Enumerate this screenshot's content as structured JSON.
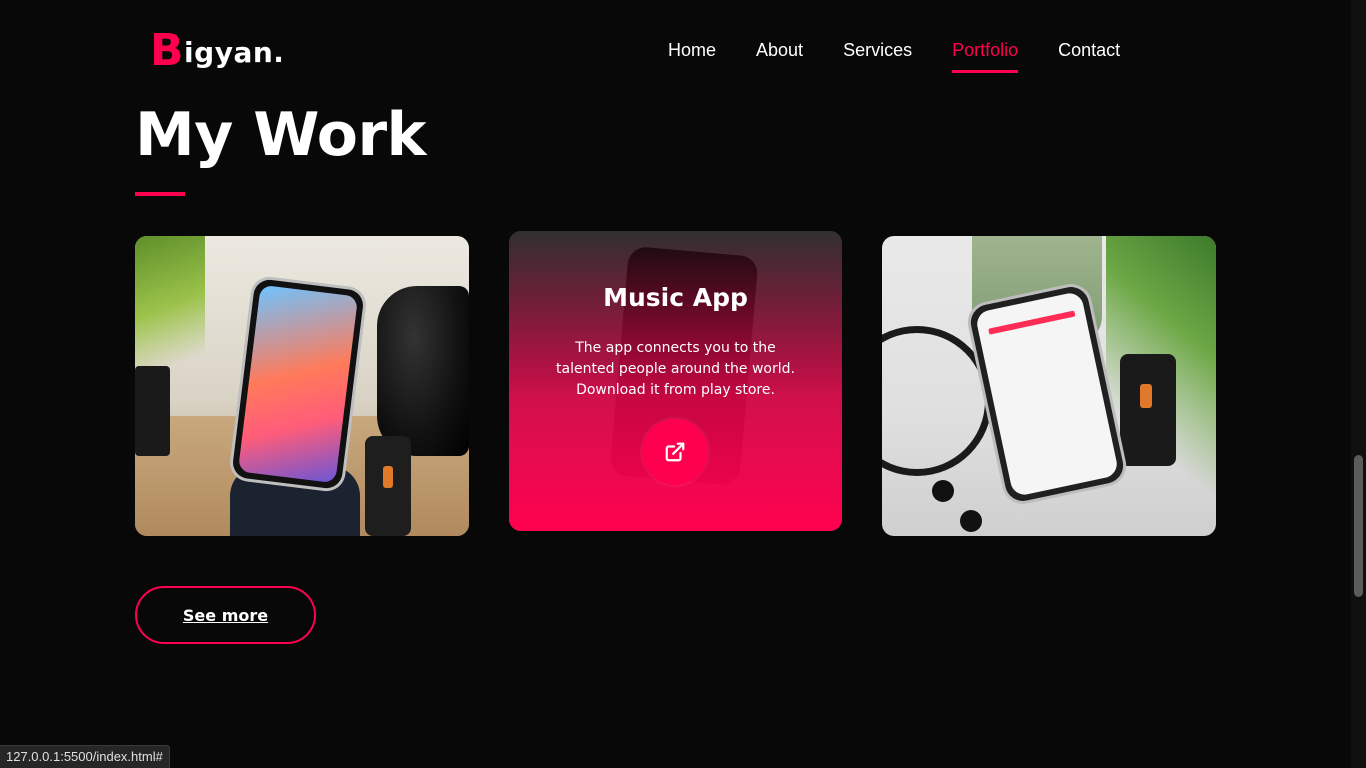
{
  "logo": {
    "first_letter": "B",
    "rest": "igyan."
  },
  "nav": {
    "items": [
      {
        "label": "Home"
      },
      {
        "label": "About"
      },
      {
        "label": "Services"
      },
      {
        "label": "Portfolio",
        "active": true
      },
      {
        "label": "Contact"
      }
    ]
  },
  "section": {
    "title": "My Work"
  },
  "cards": [
    {
      "image": "phone-on-stand-with-camera-lens"
    },
    {
      "image": "phone-in-hand-music",
      "title": "Music App",
      "description": "The app connects you to the talented people around the world. Download it from play store."
    },
    {
      "image": "phone-with-store-app-and-earbuds"
    }
  ],
  "see_more_label": "See more",
  "status_url": "127.0.0.1:5500/index.html#",
  "colors": {
    "accent": "#ff004f",
    "background": "#080808"
  }
}
